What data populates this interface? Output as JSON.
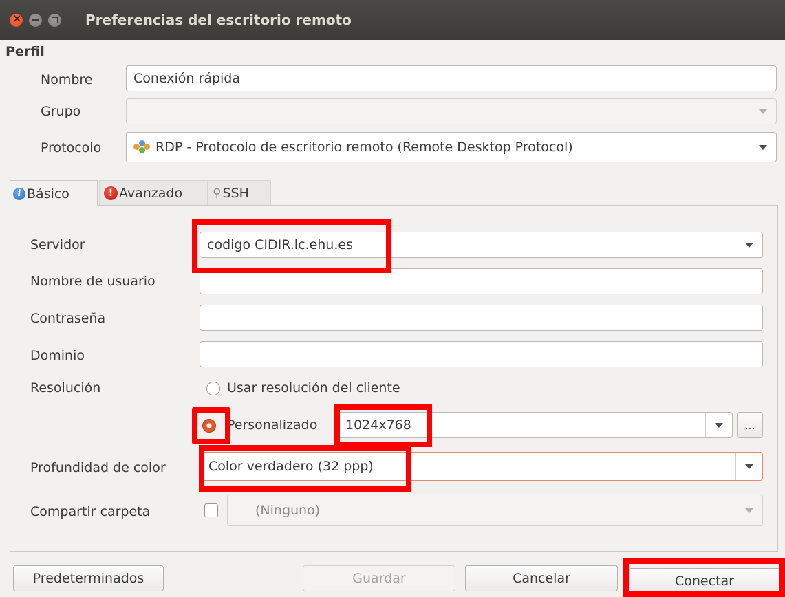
{
  "window": {
    "title": "Preferencias del escritorio remoto"
  },
  "profile": {
    "section_label": "Perfil",
    "name_label": "Nombre",
    "name_value": "Conexión rápida",
    "group_label": "Grupo",
    "group_value": "",
    "protocol_label": "Protocolo",
    "protocol_value": "RDP - Protocolo de escritorio remoto (Remote Desktop Protocol)"
  },
  "tabs": [
    {
      "label": "Básico",
      "icon": "info-icon",
      "active": true
    },
    {
      "label": "Avanzado",
      "icon": "warning-icon",
      "active": false
    },
    {
      "label": "SSH",
      "icon": "key-icon",
      "active": false
    }
  ],
  "basic": {
    "server_label": "Servidor",
    "server_value": "codigo CIDIR.lc.ehu.es",
    "username_label": "Nombre de usuario",
    "username_value": "",
    "password_label": "Contraseña",
    "password_value": "",
    "domain_label": "Dominio",
    "domain_value": "",
    "resolution_label": "Resolución",
    "resolution_client_option": "Usar resolución del cliente",
    "resolution_custom_option": "Personalizado",
    "resolution_custom_selected": true,
    "resolution_value": "1024x768",
    "resolution_more_label": "...",
    "color_depth_label": "Profundidad de color",
    "color_depth_value": "Color verdadero (32 ppp)",
    "share_folder_label": "Compartir carpeta",
    "share_folder_value": "(Ninguno)",
    "share_folder_checked": false
  },
  "buttons": {
    "defaults": "Predeterminados",
    "save": "Guardar",
    "cancel": "Cancelar",
    "connect": "Conectar"
  },
  "colors": {
    "highlight": "#ff0000",
    "titlebar": "#3c3b37",
    "radio_accent": "#e05a2b"
  }
}
